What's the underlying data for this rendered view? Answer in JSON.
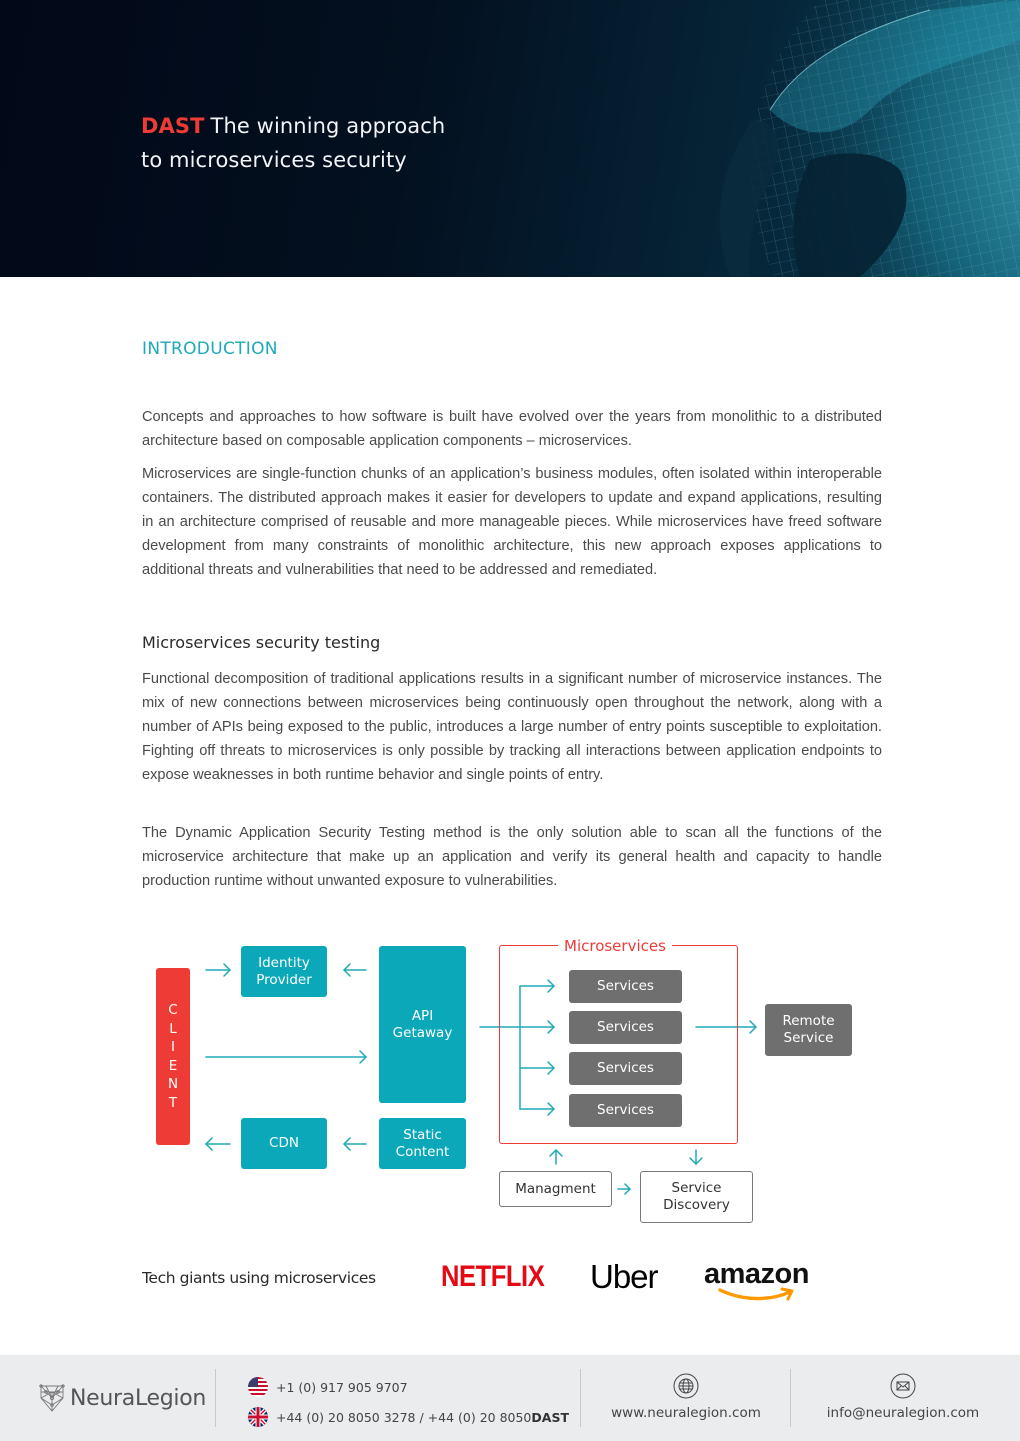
{
  "hero": {
    "title_accent": "DAST",
    "title_line1": "The winning approach",
    "title_line2": "to microservices security",
    "colors": {
      "accent": "#ef3b36",
      "background": "#020818"
    }
  },
  "intro": {
    "heading": "INTRODUCTION",
    "paragraphs": [
      "Concepts and approaches to how software is built have evolved over the years from monolithic to a distributed architecture based on composable application components – microservices.",
      "Microservices are single-function chunks of an application’s business modules, often isolated within interoperable containers. The distributed approach makes it easier for developers to update and expand applications, resulting in an architecture comprised of reusable and more manageable pieces. While microservices have freed software development from many constraints of monolithic architecture, this new approach exposes applications to additional threats and vulnerabilities that need to be addressed and remediated."
    ]
  },
  "testing": {
    "heading": "Microservices security testing",
    "paragraphs": [
      "Functional decomposition of traditional applications results in a significant number of microservice instances. The mix of new connections between microservices being continuously open throughout the network, along with a number of APIs being exposed to the public, introduces a large number of entry points susceptible to exploitation. Fighting off threats to microservices is only possible by tracking all interactions between application endpoints to expose weaknesses in both runtime behavior and single points of entry.",
      "The Dynamic Application Security Testing method is the only solution able to scan all the functions of the microservice architecture that make up an application and verify its general health and capacity to handle production runtime without unwanted exposure to vulnerabilities."
    ]
  },
  "diagram": {
    "client_letters": [
      "C",
      "L",
      "I",
      "E",
      "N",
      "T"
    ],
    "identity_provider": [
      "Identity",
      "Provider"
    ],
    "api_gateway": [
      "API",
      "Getaway"
    ],
    "cdn": "CDN",
    "static_content": [
      "Static",
      "Content"
    ],
    "microservices_label": "Microservices",
    "services": [
      "Services",
      "Services",
      "Services",
      "Services"
    ],
    "remote_service": [
      "Remote",
      "Service"
    ],
    "management": "Managment",
    "service_discovery": [
      "Service",
      "Discovery"
    ],
    "colors": {
      "teal": "#0aa8b9",
      "red": "#ef3b36",
      "gray": "#6f6f6f",
      "arrow": "#1eaab8"
    }
  },
  "giants": {
    "label": "Tech giants using microservices",
    "logos": [
      "NETFLIX",
      "Uber",
      "amazon"
    ]
  },
  "footer": {
    "brand": "NeuraLegion",
    "phone_us": "+1 (0) 917 905 9707",
    "phone_uk_prefix": "+44 (0) 20 8050 3278 / +44 (0) 20 8050 ",
    "phone_uk_suffix": "DAST",
    "website": "www.neuralegion.com",
    "email": "info@neuralegion.com",
    "icons": [
      "us-flag-icon",
      "uk-flag-icon",
      "globe-icon",
      "mail-icon",
      "neuralegion-logo-icon"
    ]
  }
}
